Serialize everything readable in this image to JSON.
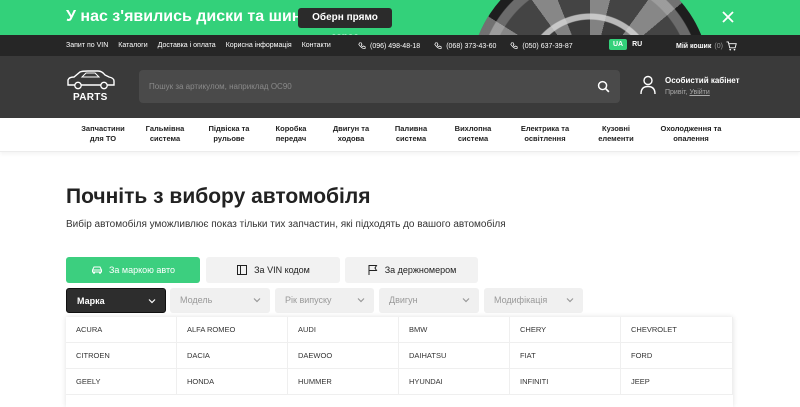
{
  "promo": {
    "text": "У нас з'явились диски та шини!",
    "button": "Оберн прямо зараз"
  },
  "topbar": {
    "links": [
      "Запит по VIN",
      "Каталоги",
      "Доставка і оплата",
      "Корисна інформація",
      "Контакти"
    ],
    "phones": [
      "(096) 498-48-18",
      "(068) 373-43-60",
      "(050) 637-39-87"
    ],
    "lang_active": "UA",
    "lang_other": "RU",
    "cart_label": "Мій кошик",
    "cart_count": "(0)"
  },
  "header": {
    "logo_text": "PARTS",
    "search_placeholder": "Пошук за артикулом, наприклад OC90",
    "account_title": "Особистий кабінет",
    "account_greeting": "Привіт,",
    "account_login": "Увійти"
  },
  "categories": [
    {
      "line1": "Запчастини",
      "line2": "для ТО"
    },
    {
      "line1": "Гальмівна",
      "line2": "система"
    },
    {
      "line1": "Підвіска та",
      "line2": "рульове"
    },
    {
      "line1": "Коробка",
      "line2": "передач"
    },
    {
      "line1": "Двигун та",
      "line2": "ходова"
    },
    {
      "line1": "Паливна",
      "line2": "система"
    },
    {
      "line1": "Вихлопна",
      "line2": "система"
    },
    {
      "line1": "Електрика та",
      "line2": "освітлення"
    },
    {
      "line1": "Кузовні",
      "line2": "елементи"
    },
    {
      "line1": "Охолодження та",
      "line2": "опалення"
    }
  ],
  "main": {
    "title": "Почніть з вибору автомобіля",
    "subtitle": "Вибір автомобіля уможливлює показ тільки тих запчастин, які підходять до вашого автомобіля"
  },
  "tabs": [
    "За маркою авто",
    "За VIN кодом",
    "За держномером"
  ],
  "selects": [
    "Марка",
    "Модель",
    "Рік випуску",
    "Двигун",
    "Модифікація"
  ],
  "brands": [
    [
      "ACURA",
      "ALFA ROMEO",
      "AUDI",
      "BMW",
      "CHERY",
      "CHEVROLET"
    ],
    [
      "CITROEN",
      "DACIA",
      "DAEWOO",
      "DAIHATSU",
      "FIAT",
      "FORD"
    ],
    [
      "GEELY",
      "HONDA",
      "HUMMER",
      "HYUNDAI",
      "INFINITI",
      "JEEP"
    ]
  ],
  "colors": {
    "accent": "#33d17a",
    "dark": "#262626",
    "header": "#3a3a3a"
  }
}
